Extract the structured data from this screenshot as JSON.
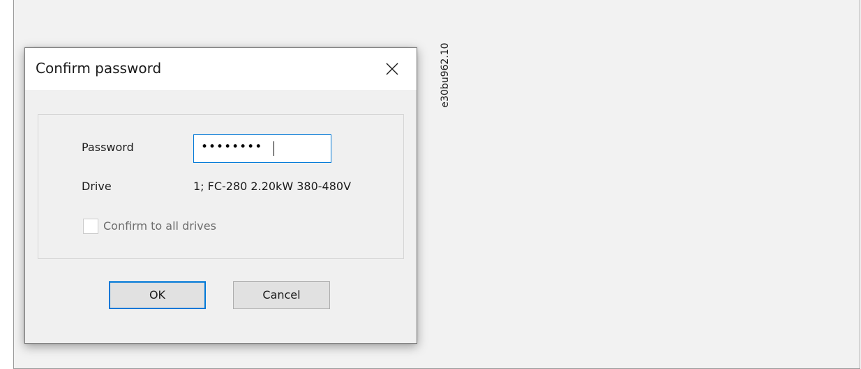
{
  "dialog": {
    "title": "Confirm password",
    "close_icon": "close-icon",
    "password_label": "Password",
    "password_value": "••••••••",
    "drive_label": "Drive",
    "drive_value": "1; FC-280 2.20kW 380-480V",
    "confirm_all_label": "Confirm to all drives",
    "confirm_all_checked": false,
    "confirm_all_enabled": false,
    "ok_label": "OK",
    "cancel_label": "Cancel"
  },
  "figure_id": "e30bu962.10",
  "colors": {
    "accent": "#0078d7",
    "disabled_text": "#6d6d6d",
    "dialog_bg": "#f0f0f0",
    "button_bg": "#e1e1e1"
  }
}
